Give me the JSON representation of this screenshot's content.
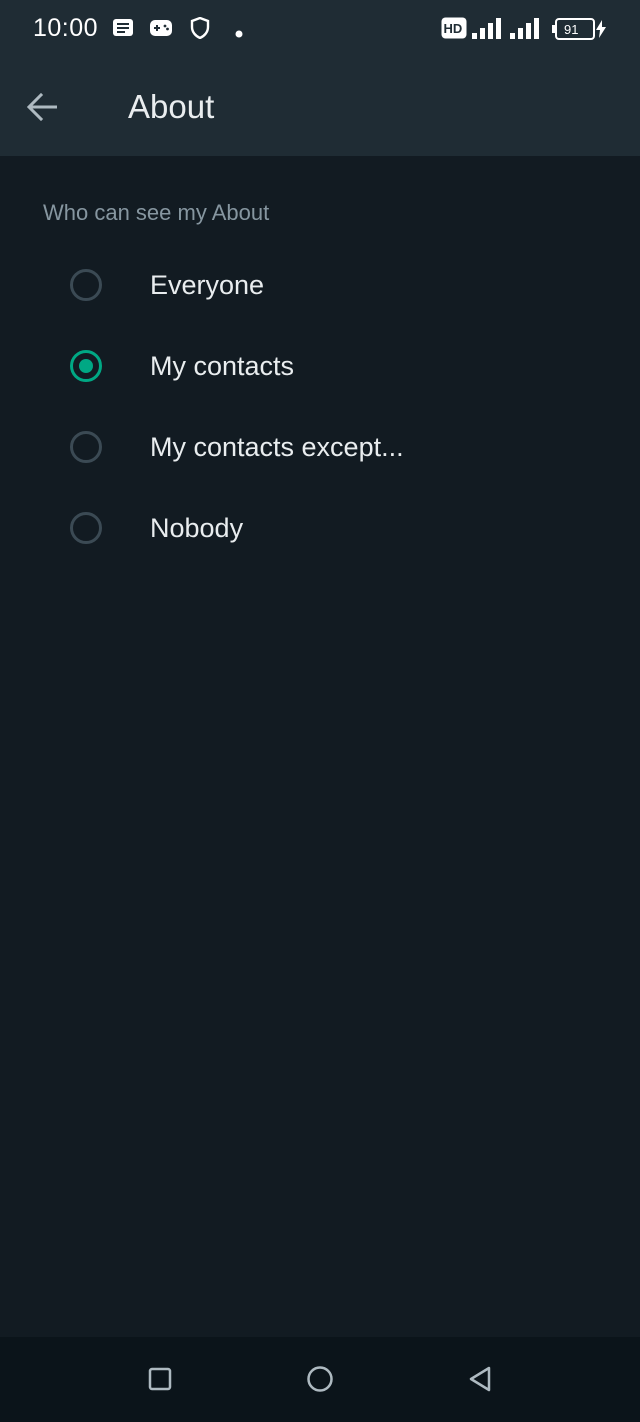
{
  "status_bar": {
    "time": "10:00",
    "battery_level": "91",
    "network_badge": "HD",
    "icons": [
      "message-icon",
      "game-controller-icon",
      "shield-icon",
      "dot-icon",
      "hd-icon",
      "signal-icon",
      "signal-icon",
      "battery-icon",
      "charging-icon"
    ]
  },
  "app_bar": {
    "title": "About",
    "back_icon": "arrow-left-icon"
  },
  "section": {
    "label": "Who can see my About"
  },
  "options": [
    {
      "label": "Everyone",
      "selected": false
    },
    {
      "label": "My contacts",
      "selected": true
    },
    {
      "label": "My contacts except...",
      "selected": false
    },
    {
      "label": "Nobody",
      "selected": false
    }
  ],
  "nav_bar": {
    "icons": [
      "recents-square-icon",
      "home-circle-icon",
      "back-triangle-icon"
    ]
  },
  "colors": {
    "background": "#121b22",
    "app_bar": "#1f2c34",
    "accent": "#00a884",
    "radio_unchecked": "#3b4a54",
    "secondary_text": "#8696a0",
    "primary_text": "#e9edef"
  }
}
